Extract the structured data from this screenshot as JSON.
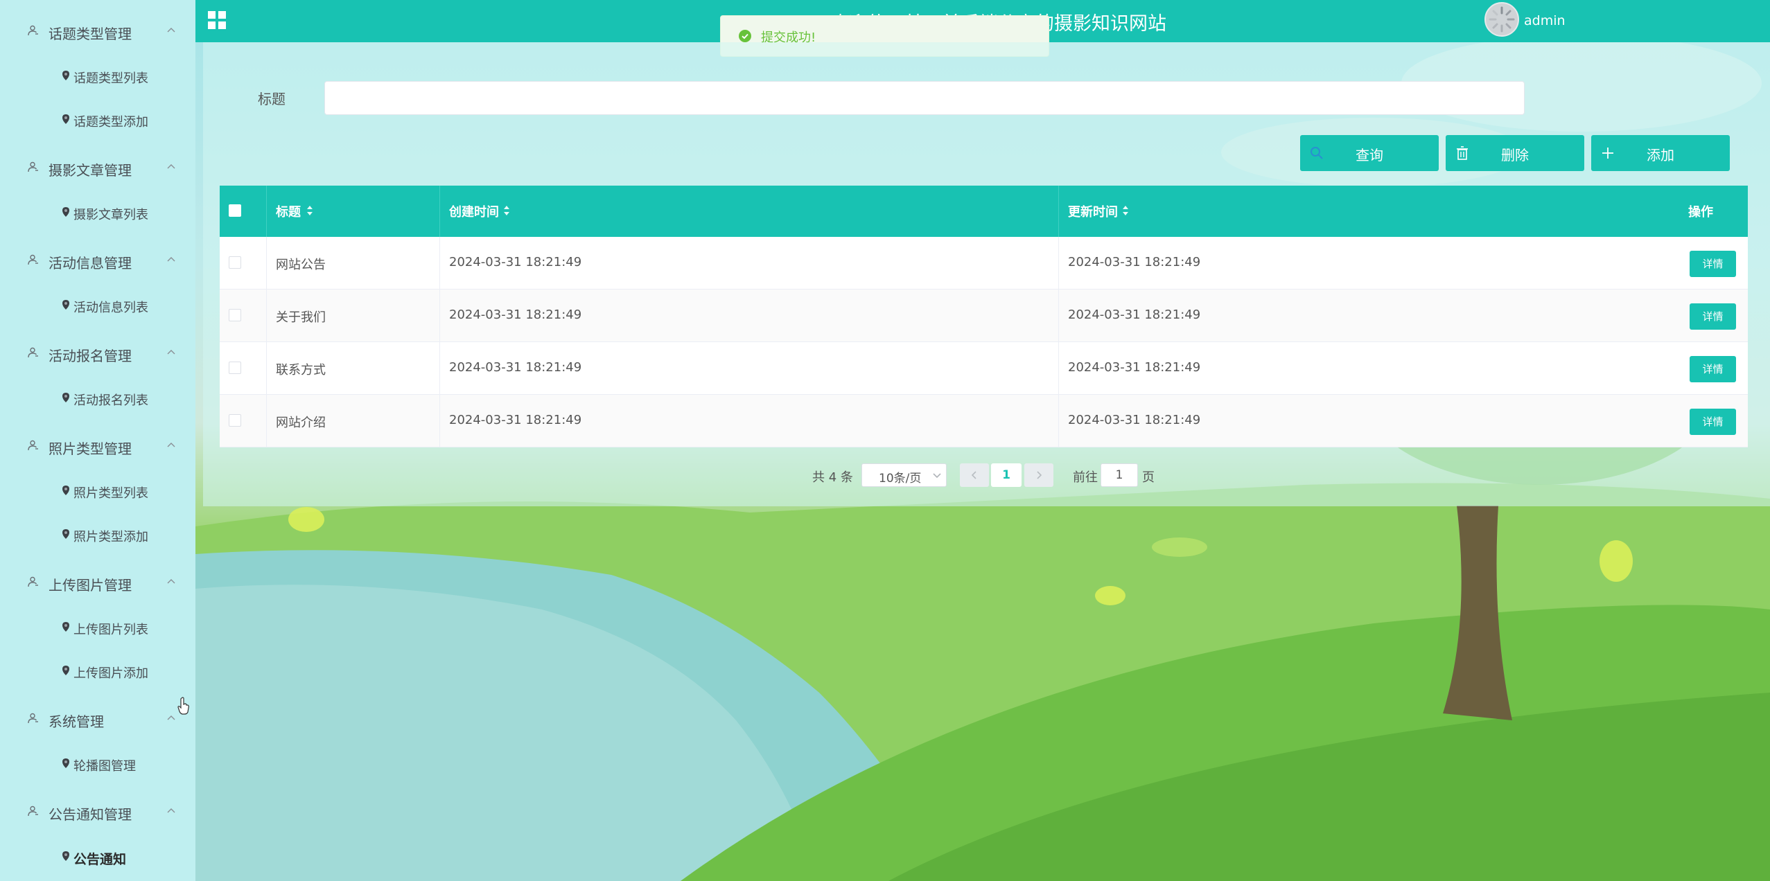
{
  "header": {
    "title": "欢迎使用基于前后端分离的摄影知识网站",
    "username": "admin"
  },
  "toast": {
    "message": "提交成功!"
  },
  "sidebar": {
    "groups": [
      {
        "label": "话题类型管理",
        "items": [
          "话题类型列表",
          "话题类型添加"
        ]
      },
      {
        "label": "摄影文章管理",
        "items": [
          "摄影文章列表"
        ]
      },
      {
        "label": "活动信息管理",
        "items": [
          "活动信息列表"
        ]
      },
      {
        "label": "活动报名管理",
        "items": [
          "活动报名列表"
        ]
      },
      {
        "label": "照片类型管理",
        "items": [
          "照片类型列表",
          "照片类型添加"
        ]
      },
      {
        "label": "上传图片管理",
        "items": [
          "上传图片列表",
          "上传图片添加"
        ]
      },
      {
        "label": "系统管理",
        "items": [
          "轮播图管理"
        ]
      },
      {
        "label": "公告通知管理",
        "items": [
          "公告通知"
        ]
      }
    ],
    "active_item": "公告通知"
  },
  "search": {
    "label": "标题",
    "value": "",
    "placeholder": ""
  },
  "buttons": {
    "query": "查询",
    "delete": "删除",
    "add": "添加"
  },
  "table": {
    "columns": [
      "标题",
      "创建时间",
      "更新时间",
      "操作"
    ],
    "rows": [
      {
        "title": "网站公告",
        "created": "2024-03-31 18:21:49",
        "updated": "2024-03-31 18:21:49",
        "action": "详情"
      },
      {
        "title": "关于我们",
        "created": "2024-03-31 18:21:49",
        "updated": "2024-03-31 18:21:49",
        "action": "详情"
      },
      {
        "title": "联系方式",
        "created": "2024-03-31 18:21:49",
        "updated": "2024-03-31 18:21:49",
        "action": "详情"
      },
      {
        "title": "网站介绍",
        "created": "2024-03-31 18:21:49",
        "updated": "2024-03-31 18:21:49",
        "action": "详情"
      }
    ]
  },
  "pagination": {
    "total": "共 4 条",
    "page_size": "10条/页",
    "current_page": "1",
    "goto_label": "前往",
    "goto_value": "1",
    "page_suffix": "页"
  },
  "colors": {
    "accent": "#18c2b2",
    "success": "#67c23a",
    "sidebar_bg": "#bfeff0"
  },
  "icons": [
    "grid-icon",
    "user-icon",
    "chevron-up-icon",
    "pin-icon",
    "search-icon",
    "trash-icon",
    "plus-icon",
    "check-circle-icon",
    "sort-icon",
    "chevron-left-icon",
    "chevron-right-icon",
    "chevron-down-icon"
  ]
}
